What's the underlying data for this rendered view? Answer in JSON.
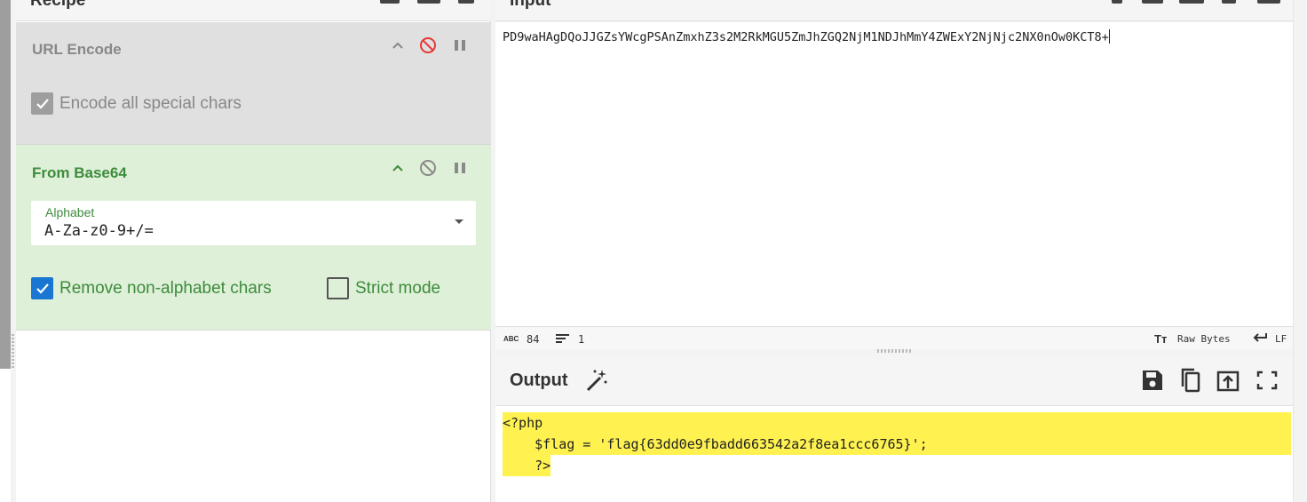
{
  "recipe": {
    "title": "Recipe",
    "operations": [
      {
        "name": "URL Encode",
        "state": "disabled",
        "checkbox_label": "Encode all special chars",
        "checked": true
      },
      {
        "name": "From Base64",
        "state": "active",
        "alphabet_label": "Alphabet",
        "alphabet_value": "A-Za-z0-9+/=",
        "remove_label": "Remove non-alphabet chars",
        "remove_checked": true,
        "strict_label": "Strict mode",
        "strict_checked": false
      }
    ]
  },
  "input": {
    "title": "Input",
    "text": "PD9waHAgDQoJJGZsYWcgPSAnZmxhZ3s2M2RkMGU5ZmJhZGQ2NjM1NDJhMmY4ZWExY2NjNjc2NX0nOw0KCT8+",
    "status_chars": "84",
    "status_lines": "1",
    "raw_bytes_label": "Raw Bytes",
    "eol_label": "LF"
  },
  "output": {
    "title": "Output",
    "lines": [
      "<?php",
      "    $flag = 'flag{63dd0e9fbadd663542a2f8ea1ccc6765}';",
      "    ?>"
    ]
  },
  "colors": {
    "disabled_op_bg": "#e0e0e0",
    "active_op_bg": "#dff0d8",
    "active_text": "#3d8b3d",
    "disable_icon_red": "#e53935",
    "checkbox_blue": "#1976d2",
    "output_highlight": "#fff250"
  }
}
